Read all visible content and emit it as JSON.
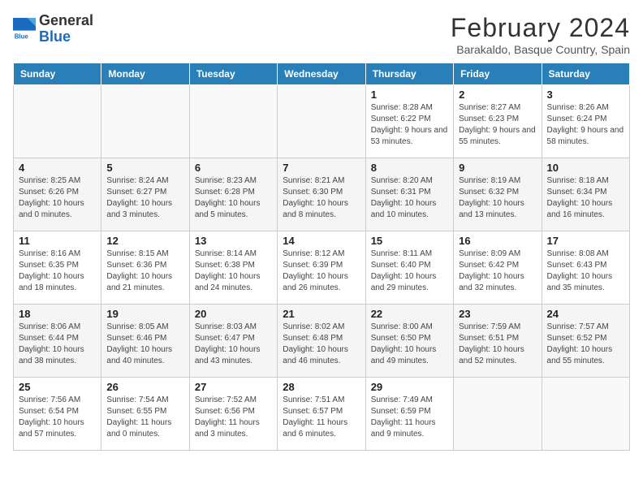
{
  "logo": {
    "general": "General",
    "blue": "Blue"
  },
  "title": "February 2024",
  "subtitle": "Barakaldo, Basque Country, Spain",
  "weekdays": [
    "Sunday",
    "Monday",
    "Tuesday",
    "Wednesday",
    "Thursday",
    "Friday",
    "Saturday"
  ],
  "weeks": [
    [
      {
        "day": "",
        "info": ""
      },
      {
        "day": "",
        "info": ""
      },
      {
        "day": "",
        "info": ""
      },
      {
        "day": "",
        "info": ""
      },
      {
        "day": "1",
        "info": "Sunrise: 8:28 AM\nSunset: 6:22 PM\nDaylight: 9 hours and 53 minutes."
      },
      {
        "day": "2",
        "info": "Sunrise: 8:27 AM\nSunset: 6:23 PM\nDaylight: 9 hours and 55 minutes."
      },
      {
        "day": "3",
        "info": "Sunrise: 8:26 AM\nSunset: 6:24 PM\nDaylight: 9 hours and 58 minutes."
      }
    ],
    [
      {
        "day": "4",
        "info": "Sunrise: 8:25 AM\nSunset: 6:26 PM\nDaylight: 10 hours and 0 minutes."
      },
      {
        "day": "5",
        "info": "Sunrise: 8:24 AM\nSunset: 6:27 PM\nDaylight: 10 hours and 3 minutes."
      },
      {
        "day": "6",
        "info": "Sunrise: 8:23 AM\nSunset: 6:28 PM\nDaylight: 10 hours and 5 minutes."
      },
      {
        "day": "7",
        "info": "Sunrise: 8:21 AM\nSunset: 6:30 PM\nDaylight: 10 hours and 8 minutes."
      },
      {
        "day": "8",
        "info": "Sunrise: 8:20 AM\nSunset: 6:31 PM\nDaylight: 10 hours and 10 minutes."
      },
      {
        "day": "9",
        "info": "Sunrise: 8:19 AM\nSunset: 6:32 PM\nDaylight: 10 hours and 13 minutes."
      },
      {
        "day": "10",
        "info": "Sunrise: 8:18 AM\nSunset: 6:34 PM\nDaylight: 10 hours and 16 minutes."
      }
    ],
    [
      {
        "day": "11",
        "info": "Sunrise: 8:16 AM\nSunset: 6:35 PM\nDaylight: 10 hours and 18 minutes."
      },
      {
        "day": "12",
        "info": "Sunrise: 8:15 AM\nSunset: 6:36 PM\nDaylight: 10 hours and 21 minutes."
      },
      {
        "day": "13",
        "info": "Sunrise: 8:14 AM\nSunset: 6:38 PM\nDaylight: 10 hours and 24 minutes."
      },
      {
        "day": "14",
        "info": "Sunrise: 8:12 AM\nSunset: 6:39 PM\nDaylight: 10 hours and 26 minutes."
      },
      {
        "day": "15",
        "info": "Sunrise: 8:11 AM\nSunset: 6:40 PM\nDaylight: 10 hours and 29 minutes."
      },
      {
        "day": "16",
        "info": "Sunrise: 8:09 AM\nSunset: 6:42 PM\nDaylight: 10 hours and 32 minutes."
      },
      {
        "day": "17",
        "info": "Sunrise: 8:08 AM\nSunset: 6:43 PM\nDaylight: 10 hours and 35 minutes."
      }
    ],
    [
      {
        "day": "18",
        "info": "Sunrise: 8:06 AM\nSunset: 6:44 PM\nDaylight: 10 hours and 38 minutes."
      },
      {
        "day": "19",
        "info": "Sunrise: 8:05 AM\nSunset: 6:46 PM\nDaylight: 10 hours and 40 minutes."
      },
      {
        "day": "20",
        "info": "Sunrise: 8:03 AM\nSunset: 6:47 PM\nDaylight: 10 hours and 43 minutes."
      },
      {
        "day": "21",
        "info": "Sunrise: 8:02 AM\nSunset: 6:48 PM\nDaylight: 10 hours and 46 minutes."
      },
      {
        "day": "22",
        "info": "Sunrise: 8:00 AM\nSunset: 6:50 PM\nDaylight: 10 hours and 49 minutes."
      },
      {
        "day": "23",
        "info": "Sunrise: 7:59 AM\nSunset: 6:51 PM\nDaylight: 10 hours and 52 minutes."
      },
      {
        "day": "24",
        "info": "Sunrise: 7:57 AM\nSunset: 6:52 PM\nDaylight: 10 hours and 55 minutes."
      }
    ],
    [
      {
        "day": "25",
        "info": "Sunrise: 7:56 AM\nSunset: 6:54 PM\nDaylight: 10 hours and 57 minutes."
      },
      {
        "day": "26",
        "info": "Sunrise: 7:54 AM\nSunset: 6:55 PM\nDaylight: 11 hours and 0 minutes."
      },
      {
        "day": "27",
        "info": "Sunrise: 7:52 AM\nSunset: 6:56 PM\nDaylight: 11 hours and 3 minutes."
      },
      {
        "day": "28",
        "info": "Sunrise: 7:51 AM\nSunset: 6:57 PM\nDaylight: 11 hours and 6 minutes."
      },
      {
        "day": "29",
        "info": "Sunrise: 7:49 AM\nSunset: 6:59 PM\nDaylight: 11 hours and 9 minutes."
      },
      {
        "day": "",
        "info": ""
      },
      {
        "day": "",
        "info": ""
      }
    ]
  ]
}
